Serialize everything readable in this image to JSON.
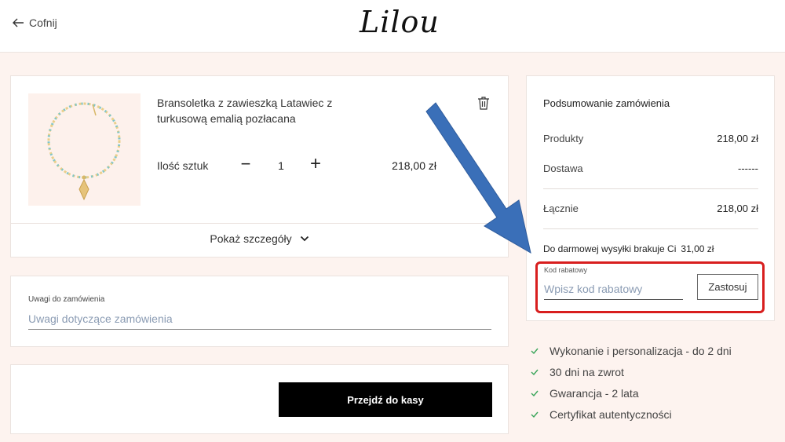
{
  "header": {
    "back_label": "Cofnij",
    "logo_text": "Lilou"
  },
  "product": {
    "name": "Bransoletka z zawieszką Latawiec z turkusową emalią pozłacana",
    "qty_label": "Ilość sztuk",
    "minus_symbol": "−",
    "quantity": "1",
    "plus_symbol": "+",
    "price": "218,00 zł",
    "details_label": "Pokaż szczegóły"
  },
  "notes": {
    "label": "Uwagi do zamówienia",
    "placeholder": "Uwagi dotyczące zamówienia"
  },
  "checkout": {
    "button_label": "Przejdź do kasy"
  },
  "summary": {
    "title": "Podsumowanie zamówienia",
    "products_label": "Produkty",
    "products_value": "218,00 zł",
    "shipping_label": "Dostawa",
    "shipping_value": "------",
    "total_label": "Łącznie",
    "total_value": "218,00 zł",
    "free_shipping_label": "Do darmowej wysyłki brakuje Ci",
    "free_shipping_value": "31,00 zł",
    "promo_label": "Kod rabatowy",
    "promo_placeholder": "Wpisz kod rabatowy",
    "promo_button": "Zastosuj"
  },
  "benefits": [
    "Wykonanie i personalizacja - do 2 dni",
    "30 dni na zwrot",
    "Gwarancja - 2 lata",
    "Certyfikat autentyczności"
  ],
  "colors": {
    "background": "#fdf3ef",
    "accent_check": "#3aa55a",
    "highlight_border": "#d81e1e",
    "annotation_arrow": "#3a6fb8",
    "button_primary": "#000000"
  },
  "icons": {
    "back": "arrow-left-icon",
    "delete": "trash-icon",
    "details": "chevron-down-icon",
    "benefit": "check-icon"
  }
}
